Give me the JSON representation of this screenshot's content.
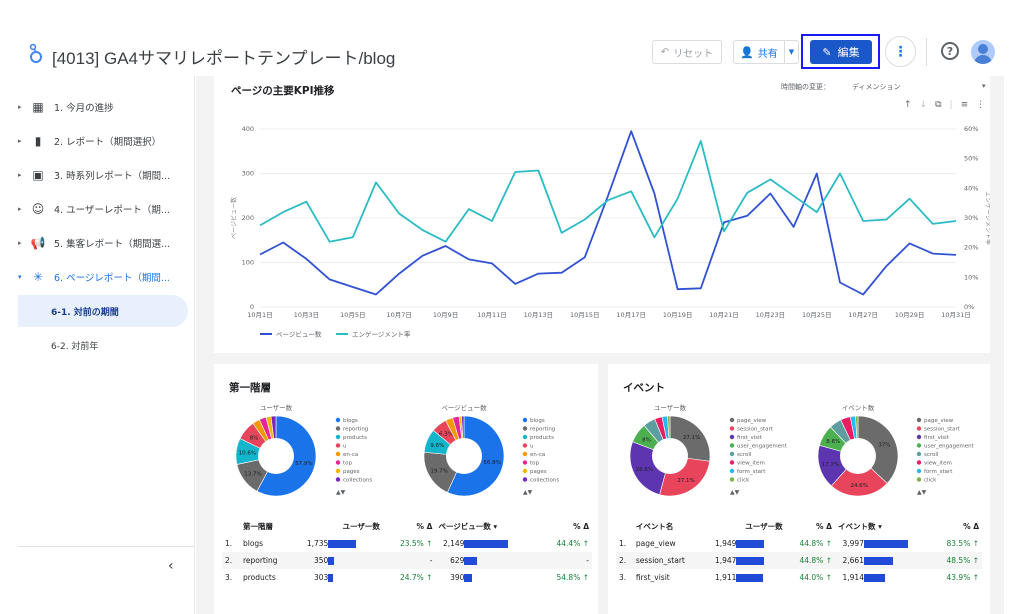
{
  "header": {
    "title": "[4013] GA4サマリレポートテンプレート/blog",
    "reset_label": "リセット",
    "share_label": "共有",
    "edit_label": "編集"
  },
  "sidebar": {
    "items": [
      {
        "label": "1. 今月の進捗",
        "icon": "dashboard-icon"
      },
      {
        "label": "2. レポート（期間選択）",
        "icon": "bar-chart-icon"
      },
      {
        "label": "3. 時系列レポート（期間...",
        "icon": "calendar-icon"
      },
      {
        "label": "4. ユーザーレポート（期...",
        "icon": "face-icon"
      },
      {
        "label": "5. 集客レポート（期間選...",
        "icon": "campaign-icon"
      },
      {
        "label": "6. ページレポート（期間...",
        "icon": "spinner-icon"
      }
    ],
    "subitems": [
      {
        "label": "6-1. 対前の期間"
      },
      {
        "label": "6-2. 対前年"
      }
    ]
  },
  "kpi": {
    "title": "ページの主要KPI推移",
    "time_axis_label": "時間軸の変更：",
    "dimension_label": "ディメンション",
    "left_axis": "ページビュー数",
    "right_axis": "エンゲージメント率",
    "legend_pv": "ページビュー数",
    "legend_er": "エンゲージメント率"
  },
  "chart_data": {
    "type": "line",
    "x": [
      "10月1日",
      "10月2日",
      "10月3日",
      "10月4日",
      "10月5日",
      "10月6日",
      "10月7日",
      "10月8日",
      "10月9日",
      "10月10日",
      "10月11日",
      "10月12日",
      "10月13日",
      "10月14日",
      "10月15日",
      "10月16日",
      "10月17日",
      "10月18日",
      "10月19日",
      "10月20日",
      "10月21日",
      "10月22日",
      "10月23日",
      "10月24日",
      "10月25日",
      "10月26日",
      "10月27日",
      "10月28日",
      "10月29日",
      "10月30日",
      "10月31日"
    ],
    "xticks": [
      "10月1日",
      "10月3日",
      "10月5日",
      "10月7日",
      "10月9日",
      "10月11日",
      "10月13日",
      "10月15日",
      "10月17日",
      "10月19日",
      "10月21日",
      "10月23日",
      "10月25日",
      "10月27日",
      "10月29日",
      "10月31日"
    ],
    "yticks_left": [
      "0",
      "100",
      "200",
      "300",
      "400"
    ],
    "yticks_right": [
      "0%",
      "10%",
      "20%",
      "30%",
      "40%",
      "50%",
      "60%"
    ],
    "ylim_left": [
      0,
      400
    ],
    "ylim_right": [
      0,
      60
    ],
    "series": [
      {
        "name": "ページビュー数",
        "axis": "left",
        "color": "#3151d3",
        "values": [
          118,
          145,
          108,
          62,
          45,
          28,
          75,
          115,
          137,
          107,
          98,
          52,
          75,
          77,
          112,
          250,
          395,
          255,
          40,
          42,
          190,
          205,
          255,
          180,
          300,
          55,
          28,
          92,
          143,
          120,
          117
        ]
      },
      {
        "name": "エンゲージメント率",
        "axis": "right",
        "color": "#2bbbc4",
        "values": [
          27.5,
          32,
          35.5,
          22,
          23.5,
          42,
          31.5,
          26,
          22,
          33,
          29,
          45.5,
          46,
          25,
          29.5,
          36,
          39,
          23.5,
          36.5,
          56,
          25.5,
          38.5,
          43,
          37.5,
          32,
          45,
          29,
          29.5,
          36.5,
          28,
          29
        ]
      }
    ]
  },
  "section1": {
    "title": "第一階層",
    "pie1_title": "ユーザー数",
    "pie2_title": "ページビュー数",
    "legend": [
      {
        "label": "blogs",
        "color": "#1a73e8"
      },
      {
        "label": "reporting",
        "color": "#6b6b6b"
      },
      {
        "label": "products",
        "color": "#12b5cb"
      },
      {
        "label": "u",
        "color": "#e8455c"
      },
      {
        "label": "en-ca",
        "color": "#f29900"
      },
      {
        "label": "top",
        "color": "#e52592"
      },
      {
        "label": "pages",
        "color": "#f4b400"
      },
      {
        "label": "collections",
        "color": "#7627bb"
      }
    ],
    "pie1_slices": [
      57.9,
      13.7,
      10.6,
      8.0,
      3.0,
      2.8,
      2.0,
      2.0
    ],
    "pie1_labels": [
      "57.9%",
      "13.7%",
      "10.6%",
      "8%"
    ],
    "pie2_slices": [
      56.8,
      19.7,
      9.6,
      6.3,
      3.0,
      2.6,
      1.0,
      1.0
    ],
    "pie2_labels": [
      "56.8%",
      "19.7%",
      "9.6%",
      "6.3%"
    ],
    "table": {
      "headers": [
        "第一階層",
        "ユーザー数",
        "% Δ",
        "ページビュー数 ▾",
        "% Δ"
      ],
      "rows": [
        {
          "n": "1.",
          "name": "blogs",
          "v1": "1,735",
          "b1": 1.0,
          "d1": "23.5% ↑",
          "v2": "2,149",
          "b2": 1.0,
          "d2": "44.4% ↑"
        },
        {
          "n": "2.",
          "name": "reporting",
          "v1": "350",
          "b1": 0.2,
          "d1": "-",
          "v2": "629",
          "b2": 0.29,
          "d2": "-"
        },
        {
          "n": "3.",
          "name": "products",
          "v1": "303",
          "b1": 0.17,
          "d1": "24.7% ↑",
          "v2": "390",
          "b2": 0.18,
          "d2": "54.8% ↑"
        }
      ]
    }
  },
  "section2": {
    "title": "イベント",
    "pie1_title": "ユーザー数",
    "pie2_title": "イベント数",
    "legend": [
      {
        "label": "page_view",
        "color": "#6b6b6b"
      },
      {
        "label": "session_start",
        "color": "#e8455c"
      },
      {
        "label": "first_visit",
        "color": "#5e35b1"
      },
      {
        "label": "user_engagement",
        "color": "#4caf50"
      },
      {
        "label": "scroll",
        "color": "#5f9ea0"
      },
      {
        "label": "view_item",
        "color": "#e91e63"
      },
      {
        "label": "form_start",
        "color": "#29b6f6"
      },
      {
        "label": "click",
        "color": "#7cb342"
      }
    ],
    "pie1_slices": [
      27.1,
      27.1,
      26.6,
      8.0,
      5.0,
      3.0,
      2.2,
      1.0
    ],
    "pie1_labels": [
      "27.1%",
      "27.1%",
      "26.6%",
      "8%"
    ],
    "pie2_slices": [
      37.0,
      24.6,
      17.7,
      8.6,
      5.0,
      4.0,
      2.1,
      1.0
    ],
    "pie2_labels": [
      "37%",
      "24.6%",
      "17.7%",
      "8.6%"
    ],
    "table": {
      "headers": [
        "イベント名",
        "ユーザー数",
        "% Δ",
        "イベント数 ▾",
        "% Δ"
      ],
      "rows": [
        {
          "n": "1.",
          "name": "page_view",
          "v1": "1,949",
          "b1": 1.0,
          "d1": "44.8% ↑",
          "v2": "3,997",
          "b2": 1.0,
          "d2": "83.5% ↑"
        },
        {
          "n": "2.",
          "name": "session_start",
          "v1": "1,947",
          "b1": 1.0,
          "d1": "44.8% ↑",
          "v2": "2,661",
          "b2": 0.67,
          "d2": "48.5% ↑"
        },
        {
          "n": "3.",
          "name": "first_visit",
          "v1": "1,911",
          "b1": 0.98,
          "d1": "44.0% ↑",
          "v2": "1,914",
          "b2": 0.48,
          "d2": "43.9% ↑"
        }
      ]
    }
  }
}
